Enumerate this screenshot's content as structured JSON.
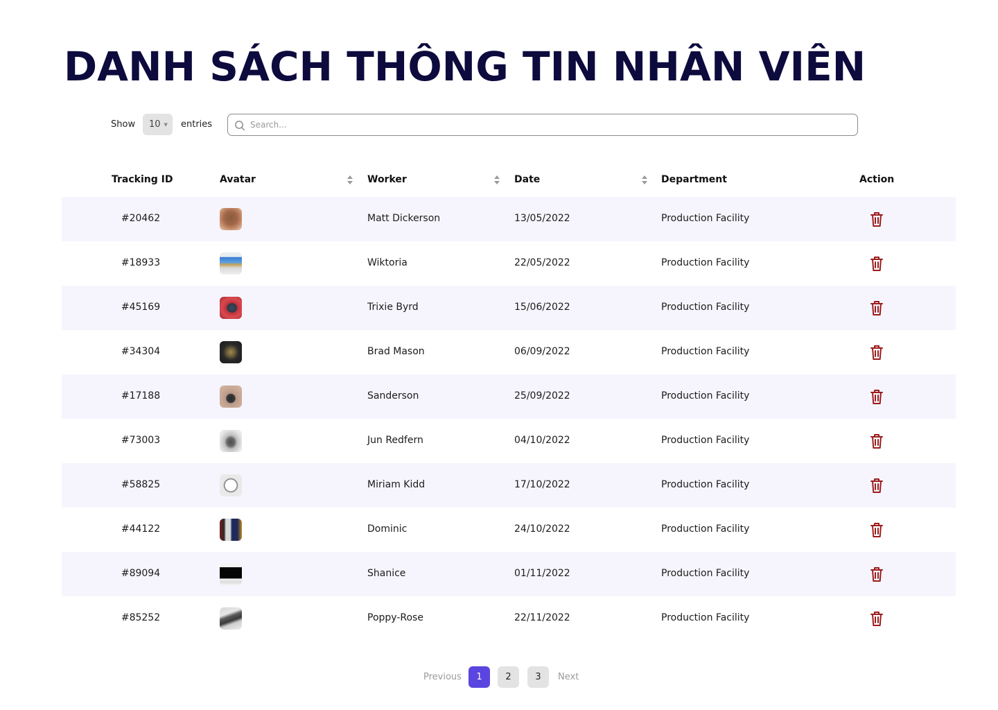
{
  "title": "DANH SÁCH THÔNG TIN NHÂN VIÊN",
  "controls": {
    "show_label": "Show",
    "entries_value": "10",
    "entries_label": "entries",
    "search_placeholder": "Search..."
  },
  "table": {
    "headers": {
      "tracking_id": "Tracking ID",
      "avatar": "Avatar",
      "worker": "Worker",
      "date": "Date",
      "department": "Department",
      "action": "Action"
    },
    "rows": [
      {
        "id": "#20462",
        "avatar": "hat-photo",
        "worker": "Matt Dickerson",
        "date": "13/05/2022",
        "department": "Production Facility"
      },
      {
        "id": "#18933",
        "avatar": "laptop-photo",
        "worker": "Wiktoria",
        "date": "22/05/2022",
        "department": "Production Facility"
      },
      {
        "id": "#45169",
        "avatar": "phone-photo",
        "worker": "Trixie Byrd",
        "date": "15/06/2022",
        "department": "Production Facility"
      },
      {
        "id": "#34304",
        "avatar": "watch-photo",
        "worker": "Brad Mason",
        "date": "06/09/2022",
        "department": "Production Facility"
      },
      {
        "id": "#17188",
        "avatar": "headphones-photo",
        "worker": "Sanderson",
        "date": "25/09/2022",
        "department": "Production Facility"
      },
      {
        "id": "#73003",
        "avatar": "mouse-photo",
        "worker": "Jun Redfern",
        "date": "04/10/2022",
        "department": "Production Facility"
      },
      {
        "id": "#58825",
        "avatar": "clock-photo",
        "worker": "Miriam Kidd",
        "date": "17/10/2022",
        "department": "Production Facility"
      },
      {
        "id": "#44122",
        "avatar": "tablet-photo",
        "worker": "Dominic",
        "date": "24/10/2022",
        "department": "Production Facility"
      },
      {
        "id": "#89094",
        "avatar": "monitor-photo",
        "worker": "Shanice",
        "date": "01/11/2022",
        "department": "Production Facility"
      },
      {
        "id": "#85252",
        "avatar": "keyboard-photo",
        "worker": "Poppy-Rose",
        "date": "22/11/2022",
        "department": "Production Facility"
      }
    ]
  },
  "pagination": {
    "previous": "Previous",
    "pages": [
      "1",
      "2",
      "3"
    ],
    "active_page": "1",
    "next": "Next"
  },
  "colors": {
    "title": "#0d0a3d",
    "row_alt_bg": "#f6f5fd",
    "trash_icon": "#9b1c1c",
    "active_page": "#5b45e0"
  }
}
